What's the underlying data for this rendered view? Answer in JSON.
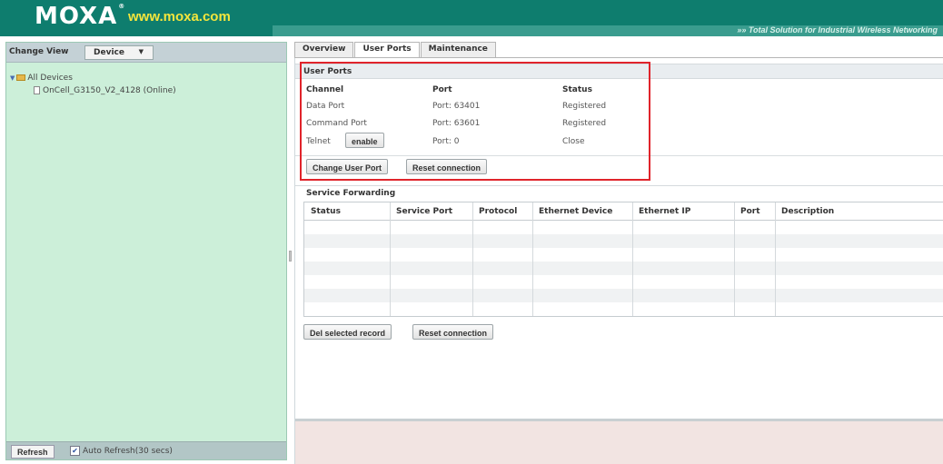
{
  "header": {
    "logo": "MOXA",
    "logo_mark": "®",
    "url": "www.moxa.com",
    "tagline": "»» Total Solution for Industrial Wireless Networking"
  },
  "left": {
    "change_view_label": "Change View",
    "view_select_value": "Device",
    "tree_root": "All Devices",
    "tree_child": "OnCell_G3150_V2_4128 (Online)",
    "refresh_label": "Refresh",
    "auto_refresh_label": "Auto Refresh(30 secs)",
    "auto_refresh_checked": true
  },
  "tabs": [
    {
      "label": "Overview",
      "active": false
    },
    {
      "label": "User Ports",
      "active": true
    },
    {
      "label": "Maintenance",
      "active": false
    }
  ],
  "user_ports": {
    "title": "User Ports",
    "columns": [
      "Channel",
      "Port",
      "Status"
    ],
    "rows": [
      {
        "channel": "Data Port",
        "port": "Port: 63401",
        "status": "Registered"
      },
      {
        "channel": "Command Port",
        "port": "Port: 63601",
        "status": "Registered"
      },
      {
        "channel": "Telnet",
        "port": "Port: 0",
        "status": "Close"
      }
    ],
    "telnet_button": "enable",
    "change_port_button": "Change User Port",
    "reset_button": "Reset connection"
  },
  "service_forwarding": {
    "title": "Service Forwarding",
    "columns": [
      "Status",
      "Service Port",
      "Protocol",
      "Ethernet Device",
      "Ethernet IP",
      "Port",
      "Description"
    ],
    "rows": [],
    "delete_button": "Del selected record",
    "reset_button": "Reset connection"
  },
  "colors": {
    "header_bg": "#0e7d6e",
    "url_text": "#f3e53d",
    "left_panel_bg": "#ccefd9",
    "highlight_border": "#e0242b",
    "bottom_area_bg": "#f2e4e2"
  }
}
